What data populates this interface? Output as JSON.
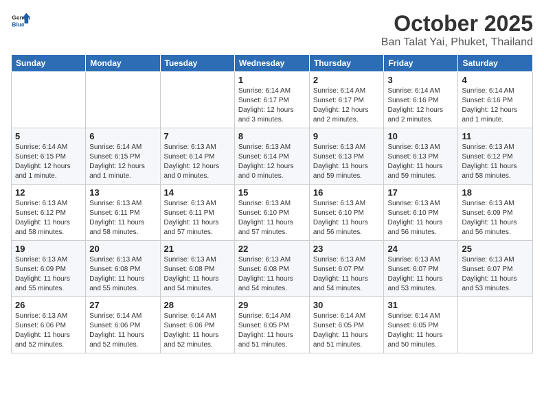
{
  "header": {
    "logo_general": "General",
    "logo_blue": "Blue",
    "month": "October 2025",
    "location": "Ban Talat Yai, Phuket, Thailand"
  },
  "weekdays": [
    "Sunday",
    "Monday",
    "Tuesday",
    "Wednesday",
    "Thursday",
    "Friday",
    "Saturday"
  ],
  "weeks": [
    [
      {
        "day": "",
        "info": ""
      },
      {
        "day": "",
        "info": ""
      },
      {
        "day": "",
        "info": ""
      },
      {
        "day": "1",
        "info": "Sunrise: 6:14 AM\nSunset: 6:17 PM\nDaylight: 12 hours and 3 minutes."
      },
      {
        "day": "2",
        "info": "Sunrise: 6:14 AM\nSunset: 6:17 PM\nDaylight: 12 hours and 2 minutes."
      },
      {
        "day": "3",
        "info": "Sunrise: 6:14 AM\nSunset: 6:16 PM\nDaylight: 12 hours and 2 minutes."
      },
      {
        "day": "4",
        "info": "Sunrise: 6:14 AM\nSunset: 6:16 PM\nDaylight: 12 hours and 1 minute."
      }
    ],
    [
      {
        "day": "5",
        "info": "Sunrise: 6:14 AM\nSunset: 6:15 PM\nDaylight: 12 hours and 1 minute."
      },
      {
        "day": "6",
        "info": "Sunrise: 6:14 AM\nSunset: 6:15 PM\nDaylight: 12 hours and 1 minute."
      },
      {
        "day": "7",
        "info": "Sunrise: 6:13 AM\nSunset: 6:14 PM\nDaylight: 12 hours and 0 minutes."
      },
      {
        "day": "8",
        "info": "Sunrise: 6:13 AM\nSunset: 6:14 PM\nDaylight: 12 hours and 0 minutes."
      },
      {
        "day": "9",
        "info": "Sunrise: 6:13 AM\nSunset: 6:13 PM\nDaylight: 11 hours and 59 minutes."
      },
      {
        "day": "10",
        "info": "Sunrise: 6:13 AM\nSunset: 6:13 PM\nDaylight: 11 hours and 59 minutes."
      },
      {
        "day": "11",
        "info": "Sunrise: 6:13 AM\nSunset: 6:12 PM\nDaylight: 11 hours and 58 minutes."
      }
    ],
    [
      {
        "day": "12",
        "info": "Sunrise: 6:13 AM\nSunset: 6:12 PM\nDaylight: 11 hours and 58 minutes."
      },
      {
        "day": "13",
        "info": "Sunrise: 6:13 AM\nSunset: 6:11 PM\nDaylight: 11 hours and 58 minutes."
      },
      {
        "day": "14",
        "info": "Sunrise: 6:13 AM\nSunset: 6:11 PM\nDaylight: 11 hours and 57 minutes."
      },
      {
        "day": "15",
        "info": "Sunrise: 6:13 AM\nSunset: 6:10 PM\nDaylight: 11 hours and 57 minutes."
      },
      {
        "day": "16",
        "info": "Sunrise: 6:13 AM\nSunset: 6:10 PM\nDaylight: 11 hours and 56 minutes."
      },
      {
        "day": "17",
        "info": "Sunrise: 6:13 AM\nSunset: 6:10 PM\nDaylight: 11 hours and 56 minutes."
      },
      {
        "day": "18",
        "info": "Sunrise: 6:13 AM\nSunset: 6:09 PM\nDaylight: 11 hours and 56 minutes."
      }
    ],
    [
      {
        "day": "19",
        "info": "Sunrise: 6:13 AM\nSunset: 6:09 PM\nDaylight: 11 hours and 55 minutes."
      },
      {
        "day": "20",
        "info": "Sunrise: 6:13 AM\nSunset: 6:08 PM\nDaylight: 11 hours and 55 minutes."
      },
      {
        "day": "21",
        "info": "Sunrise: 6:13 AM\nSunset: 6:08 PM\nDaylight: 11 hours and 54 minutes."
      },
      {
        "day": "22",
        "info": "Sunrise: 6:13 AM\nSunset: 6:08 PM\nDaylight: 11 hours and 54 minutes."
      },
      {
        "day": "23",
        "info": "Sunrise: 6:13 AM\nSunset: 6:07 PM\nDaylight: 11 hours and 54 minutes."
      },
      {
        "day": "24",
        "info": "Sunrise: 6:13 AM\nSunset: 6:07 PM\nDaylight: 11 hours and 53 minutes."
      },
      {
        "day": "25",
        "info": "Sunrise: 6:13 AM\nSunset: 6:07 PM\nDaylight: 11 hours and 53 minutes."
      }
    ],
    [
      {
        "day": "26",
        "info": "Sunrise: 6:13 AM\nSunset: 6:06 PM\nDaylight: 11 hours and 52 minutes."
      },
      {
        "day": "27",
        "info": "Sunrise: 6:14 AM\nSunset: 6:06 PM\nDaylight: 11 hours and 52 minutes."
      },
      {
        "day": "28",
        "info": "Sunrise: 6:14 AM\nSunset: 6:06 PM\nDaylight: 11 hours and 52 minutes."
      },
      {
        "day": "29",
        "info": "Sunrise: 6:14 AM\nSunset: 6:05 PM\nDaylight: 11 hours and 51 minutes."
      },
      {
        "day": "30",
        "info": "Sunrise: 6:14 AM\nSunset: 6:05 PM\nDaylight: 11 hours and 51 minutes."
      },
      {
        "day": "31",
        "info": "Sunrise: 6:14 AM\nSunset: 6:05 PM\nDaylight: 11 hours and 50 minutes."
      },
      {
        "day": "",
        "info": ""
      }
    ]
  ]
}
